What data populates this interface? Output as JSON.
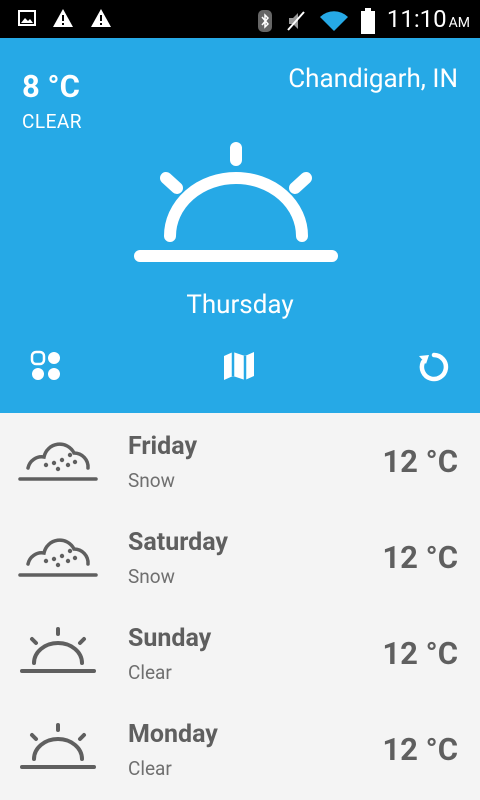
{
  "status_bar": {
    "time": "11:10",
    "ampm": "AM"
  },
  "current": {
    "temperature": "8 °C",
    "condition": "CLEAR",
    "location": "Chandigarh, IN",
    "day": "Thursday",
    "icon": "sunrise-icon"
  },
  "actions": [
    {
      "icon": "grid-icon"
    },
    {
      "icon": "map-icon"
    },
    {
      "icon": "refresh-icon"
    }
  ],
  "forecast": [
    {
      "day": "Friday",
      "condition": "Snow",
      "temperature": "12 °C",
      "icon": "snow-cloud-icon"
    },
    {
      "day": "Saturday",
      "condition": "Snow",
      "temperature": "12 °C",
      "icon": "snow-cloud-icon"
    },
    {
      "day": "Sunday",
      "condition": "Clear",
      "temperature": "12 °C",
      "icon": "sunrise-icon"
    },
    {
      "day": "Monday",
      "condition": "Clear",
      "temperature": "12 °C",
      "icon": "sunrise-icon"
    }
  ],
  "colors": {
    "accent": "#26a9e6",
    "list_bg": "#f4f4f4",
    "text_dark": "#5f5f5f"
  }
}
